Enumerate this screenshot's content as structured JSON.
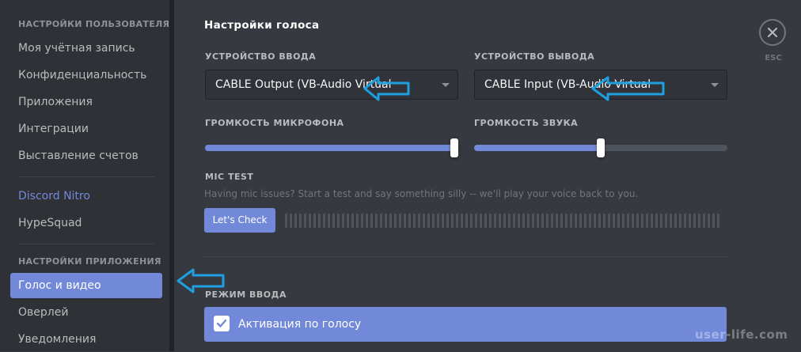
{
  "sidebar": {
    "user_settings_header": "Настройки пользователя",
    "user_items": [
      "Моя учётная запись",
      "Конфиденциальность",
      "Приложения",
      "Интеграции",
      "Выставление счетов"
    ],
    "nitro": "Discord Nitro",
    "hypesquad": "HypeSquad",
    "app_settings_header": "Настройки приложения",
    "app_items": [
      "Голос и видео",
      "Оверлей",
      "Уведомления"
    ],
    "active_item": "Голос и видео"
  },
  "main": {
    "title": "Настройки голоса",
    "input_device": {
      "label": "Устройство ввода",
      "value": "CABLE Output (VB-Audio Virtual"
    },
    "output_device": {
      "label": "Устройство вывода",
      "value": "CABLE Input (VB-Audio Virtual"
    },
    "mic_volume": {
      "label": "Громкость микрофона",
      "level": 1.0
    },
    "sound_volume": {
      "label": "Громкость звука",
      "level": 0.5
    },
    "mic_test": {
      "label": "Mic Test",
      "description": "Having mic issues? Start a test and say something silly -- we'll play your voice back to you.",
      "button": "Let's Check"
    },
    "input_mode": {
      "label": "Режим ввода",
      "selected": "Активация по голосу"
    }
  },
  "close": {
    "esc_label": "ESC",
    "icon": "close-icon"
  },
  "annotations": {
    "arrows": [
      "arrow-icon",
      "arrow-icon",
      "arrow-icon"
    ],
    "color": "#1e9fe0"
  },
  "watermark": "user-life.com",
  "colors": {
    "accent": "#7289da",
    "background": "#36393f",
    "sidebar": "#2f3136"
  }
}
